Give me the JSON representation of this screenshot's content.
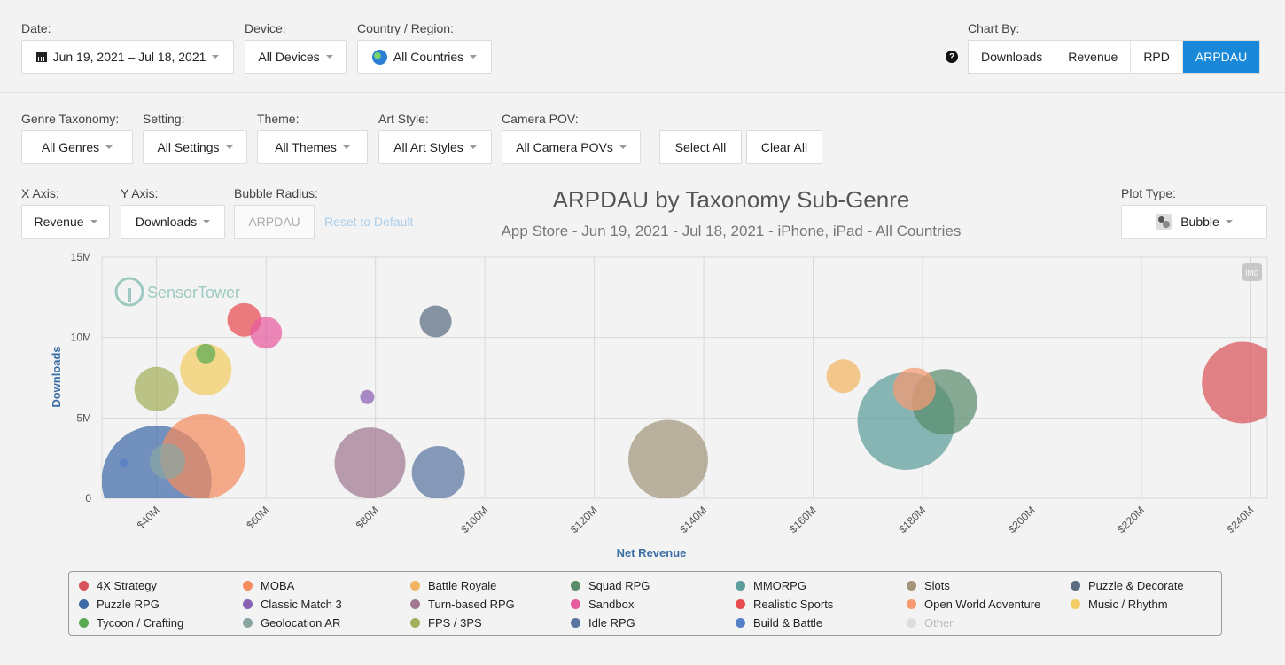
{
  "filters_top": {
    "date_label": "Date:",
    "date_value": "Jun 19, 2021 – Jul 18, 2021",
    "device_label": "Device:",
    "device_value": "All Devices",
    "country_label": "Country / Region:",
    "country_value": "All Countries",
    "chart_by_label": "Chart By:",
    "help_glyph": "?",
    "chart_by_options": [
      "Downloads",
      "Revenue",
      "RPD",
      "ARPDAU"
    ],
    "chart_by_selected": "ARPDAU"
  },
  "filters_taxonomy": {
    "genre_label": "Genre Taxonomy:",
    "genre_value": "All Genres",
    "setting_label": "Setting:",
    "setting_value": "All Settings",
    "theme_label": "Theme:",
    "theme_value": "All Themes",
    "art_label": "Art Style:",
    "art_value": "All Art Styles",
    "camera_label": "Camera POV:",
    "camera_value": "All Camera POVs",
    "select_all": "Select All",
    "clear_all": "Clear All"
  },
  "axes_controls": {
    "x_label": "X Axis:",
    "x_value": "Revenue",
    "y_label": "Y Axis:",
    "y_value": "Downloads",
    "radius_label": "Bubble Radius:",
    "radius_value": "ARPDAU",
    "reset": "Reset to Default",
    "plot_type_label": "Plot Type:",
    "plot_type_value": "Bubble"
  },
  "watermark": "SensorTower",
  "img_badge": "IMG",
  "chart_data": {
    "type": "scatter",
    "title": "ARPDAU by Taxonomy Sub-Genre",
    "subtitle": "App Store - Jun 19, 2021 - Jul 18, 2021 - iPhone, iPad - All Countries",
    "xlabel": "Net Revenue",
    "ylabel": "Downloads",
    "xlim": [
      30,
      243
    ],
    "ylim": [
      0,
      15
    ],
    "x_ticks": [
      "$40M",
      "$60M",
      "$80M",
      "$100M",
      "$120M",
      "$140M",
      "$160M",
      "$180M",
      "$200M",
      "$220M",
      "$240M"
    ],
    "x_tick_values": [
      40,
      60,
      80,
      100,
      120,
      140,
      160,
      180,
      200,
      220,
      240
    ],
    "y_ticks": [
      "0",
      "5M",
      "10M",
      "15M"
    ],
    "y_tick_values": [
      0,
      5,
      10,
      15
    ],
    "grid": true,
    "legend_position": "bottom",
    "series": [
      {
        "name": "4X Strategy",
        "color": "#d9545a",
        "x": 238.5,
        "y": 7.2,
        "r": 46
      },
      {
        "name": "MOBA",
        "color": "#f48c5e",
        "x": 48.5,
        "y": 2.6,
        "r": 48
      },
      {
        "name": "Battle Royale",
        "color": "#f2b462",
        "x": 165.5,
        "y": 7.6,
        "r": 19
      },
      {
        "name": "Squad RPG",
        "color": "#5a8c6c",
        "x": 184,
        "y": 6.0,
        "r": 37
      },
      {
        "name": "MMORPG",
        "color": "#5c9c9a",
        "x": 177,
        "y": 4.8,
        "r": 55
      },
      {
        "name": "Slots",
        "color": "#a2957c",
        "x": 133.5,
        "y": 2.4,
        "r": 45
      },
      {
        "name": "Puzzle & Decorate",
        "color": "#5a6c82",
        "x": 91,
        "y": 11.0,
        "r": 18
      },
      {
        "name": "Puzzle RPG",
        "color": "#3e6aa8",
        "x": 40,
        "y": 1.1,
        "r": 62
      },
      {
        "name": "Classic Match 3",
        "color": "#8860b0",
        "x": 78.5,
        "y": 6.3,
        "r": 8
      },
      {
        "name": "Turn-based RPG",
        "color": "#a07890",
        "x": 79,
        "y": 2.2,
        "r": 40
      },
      {
        "name": "Sandbox",
        "color": "#e75c9e",
        "x": 60,
        "y": 10.3,
        "r": 18
      },
      {
        "name": "Realistic Sports",
        "color": "#e84b50",
        "x": 56,
        "y": 11.1,
        "r": 19
      },
      {
        "name": "Open World Adventure",
        "color": "#f59a72",
        "x": 178.5,
        "y": 6.8,
        "r": 24
      },
      {
        "name": "Music / Rhythm",
        "color": "#f2cc62",
        "x": 49,
        "y": 8.0,
        "r": 29
      },
      {
        "name": "Tycoon / Crafting",
        "color": "#5caa52",
        "x": 49,
        "y": 9.0,
        "r": 11
      },
      {
        "name": "Geolocation AR",
        "color": "#8aa6a2",
        "x": 42,
        "y": 2.3,
        "r": 20
      },
      {
        "name": "FPS / 3PS",
        "color": "#a3b05a",
        "x": 40,
        "y": 6.8,
        "r": 25
      },
      {
        "name": "Idle RPG",
        "color": "#5a74a0",
        "x": 91.5,
        "y": 1.6,
        "r": 30
      },
      {
        "name": "Build & Battle",
        "color": "#5580c8",
        "x": 34,
        "y": 2.2,
        "r": 5
      },
      {
        "name": "Other",
        "color": "#cccccc",
        "x": null,
        "y": null,
        "r": 0,
        "hidden": true
      }
    ]
  }
}
